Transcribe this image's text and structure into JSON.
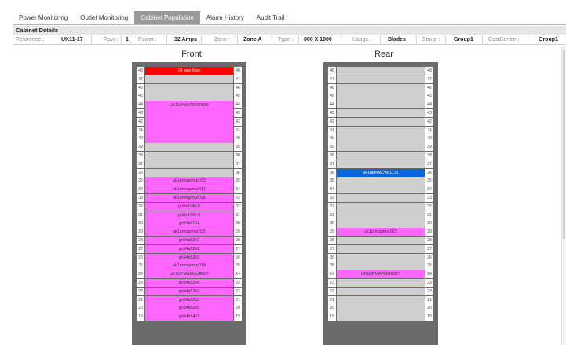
{
  "tabs": [
    {
      "label": "Power Monitoring"
    },
    {
      "label": "Outlet Monitoring"
    },
    {
      "label": "Cabinet Population",
      "active": true
    },
    {
      "label": "Alarm History"
    },
    {
      "label": "Audit Trail"
    }
  ],
  "details": {
    "header": "Cabinet Details",
    "reference_label": "Reference :",
    "reference": "UK11-17",
    "row_label": "Row :",
    "row": "1",
    "power_label": "Power :",
    "power": "32 Amps",
    "zone_label": "Zone :",
    "zone": "Zone A",
    "type_label": "Type :",
    "type": "800 X 1000",
    "usage_label": "Usage :",
    "usage": "Blades",
    "group_label": "Group :",
    "group": "Group1",
    "costcentre_label": "CostCentre :",
    "costcentre": "Group1"
  },
  "colors": {
    "red": "#ff0000",
    "magenta": "#ff66ff",
    "blue": "#0a64e0",
    "empty": "#cfcfcf",
    "frame": "#6b6b6b"
  },
  "racks": {
    "front_title": "Front",
    "rear_title": "Rear",
    "units_visible": [
      48,
      47,
      46,
      45,
      44,
      43,
      42,
      41,
      40,
      39,
      38,
      37,
      36,
      35,
      34,
      33,
      32,
      31,
      30,
      29,
      28,
      27,
      26,
      25,
      24,
      23,
      22,
      21,
      20,
      19
    ],
    "front_devices": [
      {
        "label": "24 way fibre",
        "top_u": 48,
        "height_u": 1,
        "color": "red"
      },
      {
        "label": "UK1UPMAPMUR035",
        "top_u": 44,
        "height_u": 5,
        "color": "magenta"
      },
      {
        "label": "uk1urmapmur013",
        "top_u": 35,
        "height_u": 1,
        "color": "magenta"
      },
      {
        "label": "uk1urmapmur017",
        "top_u": 34,
        "height_u": 1,
        "color": "magenta"
      },
      {
        "label": "uk1urmapmur018",
        "top_u": 33,
        "height_u": 1,
        "color": "magenta"
      },
      {
        "label": "gridx4140-8",
        "top_u": 32,
        "height_u": 1,
        "color": "magenta"
      },
      {
        "label": "gridx4140-9",
        "top_u": 31,
        "height_u": 1,
        "color": "magenta"
      },
      {
        "label": "grid4a27n1",
        "top_u": 30,
        "height_u": 1,
        "color": "magenta"
      },
      {
        "label": "uk1urmapmur023",
        "top_u": 29,
        "height_u": 1,
        "color": "magenta"
      },
      {
        "label": "grid4a52n3",
        "top_u": 28,
        "height_u": 1,
        "color": "magenta"
      },
      {
        "label": "grid4a52n1",
        "top_u": 27,
        "height_u": 1,
        "color": "magenta"
      },
      {
        "label": "grid4a52n2",
        "top_u": 26,
        "height_u": 1,
        "color": "magenta"
      },
      {
        "label": "uk1urmapmur019",
        "top_u": 25,
        "height_u": 1,
        "color": "magenta"
      },
      {
        "label": "UK1UPMAPMUR027",
        "top_u": 24,
        "height_u": 1,
        "color": "magenta"
      },
      {
        "label": "grid4a52n6",
        "top_u": 23,
        "height_u": 1,
        "color": "magenta"
      },
      {
        "label": "grid4a52n7",
        "top_u": 22,
        "height_u": 1,
        "color": "magenta"
      },
      {
        "label": "grid4a52n8",
        "top_u": 21,
        "height_u": 1,
        "color": "magenta"
      },
      {
        "label": "grid4a52n9",
        "top_u": 20,
        "height_u": 1,
        "color": "magenta"
      },
      {
        "label": "grid4a54n1",
        "top_u": 19,
        "height_u": 1,
        "color": "magenta"
      }
    ],
    "rear_devices": [
      {
        "label": "uk1npmMCwg1171",
        "top_u": 36,
        "height_u": 1,
        "color": "blue"
      },
      {
        "label": "uk1urmapmur023",
        "top_u": 29,
        "height_u": 1,
        "color": "magenta"
      },
      {
        "label": "UK1UPMAPMUR027",
        "top_u": 24,
        "height_u": 1,
        "color": "magenta"
      }
    ]
  }
}
